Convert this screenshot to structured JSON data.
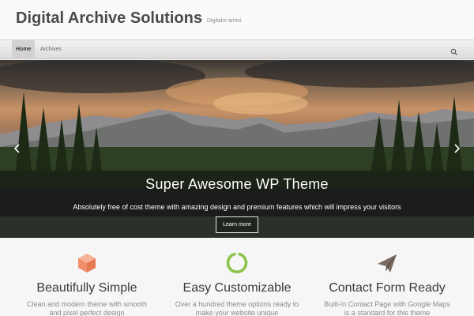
{
  "header": {
    "site_title": "Digital Archive Solutions",
    "site_description": "Digitalni arhivi"
  },
  "nav": {
    "items": [
      {
        "label": "Home",
        "active": true
      },
      {
        "label": "Archives",
        "active": false
      }
    ],
    "search_icon": "search-icon"
  },
  "slider": {
    "title": "Super Awesome WP Theme",
    "text": "Absolutely free of cost theme with amazing design and premium features which will impress your visitors",
    "button_label": "Learn more",
    "prev_icon": "chevron-left-icon",
    "next_icon": "chevron-right-icon"
  },
  "features": [
    {
      "icon": "cube-icon",
      "icon_color": "#f0906a",
      "title": "Beautifully Simple",
      "text": "Clean and modern theme with smooth and pixel perfect design"
    },
    {
      "icon": "ring-icon",
      "icon_color": "#8dc44e",
      "title": "Easy Customizable",
      "text": "Over a hundred theme options ready to make your website unique"
    },
    {
      "icon": "paper-plane-icon",
      "icon_color": "#7a6a62",
      "title": "Contact Form Ready",
      "text": "Built-In Contact Page with Google Maps is a standard for this theme"
    }
  ]
}
